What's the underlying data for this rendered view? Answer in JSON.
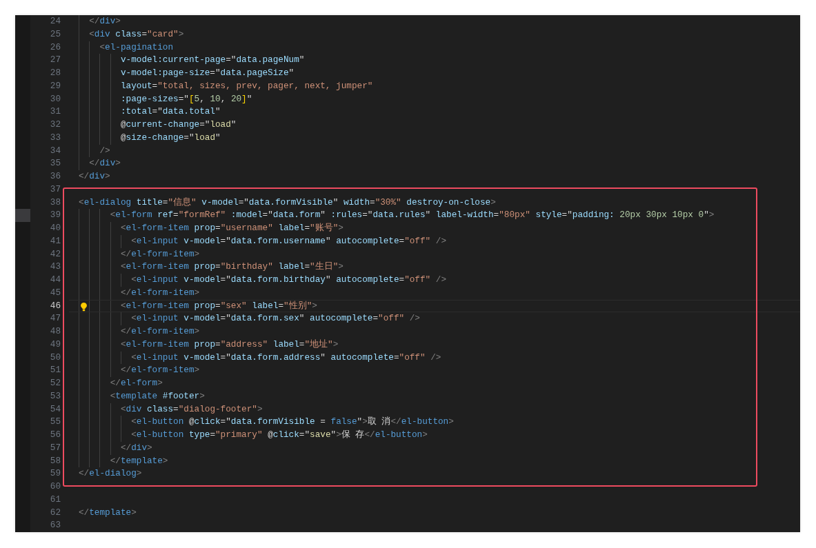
{
  "editor": {
    "lines": [
      {
        "number": "24",
        "tokens": [
          {
            "kind": "punct",
            "text": "  </"
          },
          {
            "kind": "tag",
            "text": "div"
          },
          {
            "kind": "punct",
            "text": ">"
          }
        ]
      },
      {
        "number": "25",
        "tokens": [
          {
            "kind": "punct",
            "text": "  <"
          },
          {
            "kind": "tag",
            "text": "div"
          },
          {
            "kind": "attr",
            "text": " class"
          },
          {
            "kind": "op",
            "text": "="
          },
          {
            "kind": "str",
            "text": "\"card\""
          },
          {
            "kind": "punct",
            "text": ">"
          }
        ]
      },
      {
        "number": "26",
        "tokens": [
          {
            "kind": "punct",
            "text": "    <"
          },
          {
            "kind": "tag",
            "text": "el-pagination"
          }
        ]
      },
      {
        "number": "27",
        "tokens": [
          {
            "kind": "attr",
            "text": "        v-model:current-page"
          },
          {
            "kind": "op",
            "text": "=\""
          },
          {
            "kind": "expr",
            "text": "data.pageNum"
          },
          {
            "kind": "op",
            "text": "\""
          }
        ]
      },
      {
        "number": "28",
        "tokens": [
          {
            "kind": "attr",
            "text": "        v-model:page-size"
          },
          {
            "kind": "op",
            "text": "=\""
          },
          {
            "kind": "expr",
            "text": "data.pageSize"
          },
          {
            "kind": "op",
            "text": "\""
          }
        ]
      },
      {
        "number": "29",
        "tokens": [
          {
            "kind": "attr",
            "text": "        layout"
          },
          {
            "kind": "op",
            "text": "="
          },
          {
            "kind": "str",
            "text": "\"total, sizes, prev, pager, next, jumper\""
          }
        ]
      },
      {
        "number": "30",
        "tokens": [
          {
            "kind": "attr",
            "text": "        :page-sizes"
          },
          {
            "kind": "op",
            "text": "=\""
          },
          {
            "kind": "brace",
            "text": "["
          },
          {
            "kind": "num",
            "text": "5"
          },
          {
            "kind": "op",
            "text": ", "
          },
          {
            "kind": "num",
            "text": "10"
          },
          {
            "kind": "op",
            "text": ", "
          },
          {
            "kind": "num",
            "text": "20"
          },
          {
            "kind": "brace",
            "text": "]"
          },
          {
            "kind": "op",
            "text": "\""
          }
        ]
      },
      {
        "number": "31",
        "tokens": [
          {
            "kind": "attr",
            "text": "        :total"
          },
          {
            "kind": "op",
            "text": "=\""
          },
          {
            "kind": "expr",
            "text": "data.total"
          },
          {
            "kind": "op",
            "text": "\""
          }
        ]
      },
      {
        "number": "32",
        "tokens": [
          {
            "kind": "op",
            "text": "        @"
          },
          {
            "kind": "attr",
            "text": "current-change"
          },
          {
            "kind": "op",
            "text": "=\""
          },
          {
            "kind": "func",
            "text": "load"
          },
          {
            "kind": "op",
            "text": "\""
          }
        ]
      },
      {
        "number": "33",
        "tokens": [
          {
            "kind": "op",
            "text": "        @"
          },
          {
            "kind": "attr",
            "text": "size-change"
          },
          {
            "kind": "op",
            "text": "=\""
          },
          {
            "kind": "func",
            "text": "load"
          },
          {
            "kind": "op",
            "text": "\""
          }
        ]
      },
      {
        "number": "34",
        "tokens": [
          {
            "kind": "punct",
            "text": "    />"
          }
        ]
      },
      {
        "number": "35",
        "tokens": [
          {
            "kind": "punct",
            "text": "  </"
          },
          {
            "kind": "tag",
            "text": "div"
          },
          {
            "kind": "punct",
            "text": ">"
          }
        ]
      },
      {
        "number": "36",
        "tokens": [
          {
            "kind": "punct",
            "text": "</"
          },
          {
            "kind": "tag",
            "text": "div"
          },
          {
            "kind": "punct",
            "text": ">"
          }
        ]
      },
      {
        "number": "37"
      }
    ],
    "highlight_box": {
      "lines": [
        {
          "number": "38",
          "tokens": [
            {
              "kind": "punct",
              "text": "<"
            },
            {
              "kind": "tag",
              "text": "el-dialog"
            },
            {
              "kind": "attr",
              "text": " title"
            },
            {
              "kind": "op",
              "text": "="
            },
            {
              "kind": "str",
              "text": "\"信息\""
            },
            {
              "kind": "attr",
              "text": " v-model"
            },
            {
              "kind": "op",
              "text": "=\""
            },
            {
              "kind": "expr",
              "text": "data.formVisible"
            },
            {
              "kind": "op",
              "text": "\""
            },
            {
              "kind": "attr",
              "text": " width"
            },
            {
              "kind": "op",
              "text": "="
            },
            {
              "kind": "str",
              "text": "\"30%\""
            },
            {
              "kind": "attr",
              "text": " destroy-on-close"
            },
            {
              "kind": "punct",
              "text": ">"
            }
          ]
        },
        {
          "number": "39",
          "marked": true,
          "tokens": [
            {
              "kind": "punct",
              "text": "      <"
            },
            {
              "kind": "tag",
              "text": "el-form"
            },
            {
              "kind": "attr",
              "text": " ref"
            },
            {
              "kind": "op",
              "text": "="
            },
            {
              "kind": "str",
              "text": "\"formRef\""
            },
            {
              "kind": "attr",
              "text": " :model"
            },
            {
              "kind": "op",
              "text": "=\""
            },
            {
              "kind": "expr",
              "text": "data.form"
            },
            {
              "kind": "op",
              "text": "\""
            },
            {
              "kind": "attr",
              "text": " :rules"
            },
            {
              "kind": "op",
              "text": "=\""
            },
            {
              "kind": "expr",
              "text": "data.rules"
            },
            {
              "kind": "op",
              "text": "\""
            },
            {
              "kind": "attr",
              "text": " label-width"
            },
            {
              "kind": "op",
              "text": "="
            },
            {
              "kind": "str",
              "text": "\"80px\""
            },
            {
              "kind": "attr",
              "text": " style"
            },
            {
              "kind": "op",
              "text": "=\""
            },
            {
              "kind": "expr",
              "text": "padding:"
            },
            {
              "kind": "num",
              "text": " 20px 30px 10px 0"
            },
            {
              "kind": "op",
              "text": "\""
            },
            {
              "kind": "punct",
              "text": ">"
            }
          ]
        },
        {
          "number": "40",
          "tokens": [
            {
              "kind": "punct",
              "text": "        <"
            },
            {
              "kind": "tag",
              "text": "el-form-item"
            },
            {
              "kind": "attr",
              "text": " prop"
            },
            {
              "kind": "op",
              "text": "="
            },
            {
              "kind": "str",
              "text": "\"username\""
            },
            {
              "kind": "attr",
              "text": " label"
            },
            {
              "kind": "op",
              "text": "="
            },
            {
              "kind": "str",
              "text": "\"账号\""
            },
            {
              "kind": "punct",
              "text": ">"
            }
          ]
        },
        {
          "number": "41",
          "tokens": [
            {
              "kind": "punct",
              "text": "          <"
            },
            {
              "kind": "tag",
              "text": "el-input"
            },
            {
              "kind": "attr",
              "text": " v-model"
            },
            {
              "kind": "op",
              "text": "=\""
            },
            {
              "kind": "expr",
              "text": "data.form.username"
            },
            {
              "kind": "op",
              "text": "\""
            },
            {
              "kind": "attr",
              "text": " autocomplete"
            },
            {
              "kind": "op",
              "text": "="
            },
            {
              "kind": "str",
              "text": "\"off\""
            },
            {
              "kind": "punct",
              "text": " />"
            }
          ]
        },
        {
          "number": "42",
          "tokens": [
            {
              "kind": "punct",
              "text": "        </"
            },
            {
              "kind": "tag",
              "text": "el-form-item"
            },
            {
              "kind": "punct",
              "text": ">"
            }
          ]
        },
        {
          "number": "43",
          "tokens": [
            {
              "kind": "punct",
              "text": "        <"
            },
            {
              "kind": "tag",
              "text": "el-form-item"
            },
            {
              "kind": "attr",
              "text": " prop"
            },
            {
              "kind": "op",
              "text": "="
            },
            {
              "kind": "str",
              "text": "\"birthday\""
            },
            {
              "kind": "attr",
              "text": " label"
            },
            {
              "kind": "op",
              "text": "="
            },
            {
              "kind": "str",
              "text": "\"生日\""
            },
            {
              "kind": "punct",
              "text": ">"
            }
          ]
        },
        {
          "number": "44",
          "tokens": [
            {
              "kind": "punct",
              "text": "          <"
            },
            {
              "kind": "tag",
              "text": "el-input"
            },
            {
              "kind": "attr",
              "text": " v-model"
            },
            {
              "kind": "op",
              "text": "=\""
            },
            {
              "kind": "expr",
              "text": "data.form.birthday"
            },
            {
              "kind": "op",
              "text": "\""
            },
            {
              "kind": "attr",
              "text": " autocomplete"
            },
            {
              "kind": "op",
              "text": "="
            },
            {
              "kind": "str",
              "text": "\"off\""
            },
            {
              "kind": "punct",
              "text": " />"
            }
          ]
        },
        {
          "number": "45",
          "tokens": [
            {
              "kind": "punct",
              "text": "        </"
            },
            {
              "kind": "tag",
              "text": "el-form-item"
            },
            {
              "kind": "punct",
              "text": ">"
            }
          ]
        },
        {
          "number": "46",
          "current": true,
          "lightbulb": true,
          "tokens": [
            {
              "kind": "punct",
              "text": "        <"
            },
            {
              "kind": "tag",
              "text": "el-form-item"
            },
            {
              "kind": "attr",
              "text": " prop"
            },
            {
              "kind": "op",
              "text": "="
            },
            {
              "kind": "str",
              "text": "\"sex\""
            },
            {
              "kind": "attr",
              "text": " label"
            },
            {
              "kind": "op",
              "text": "="
            },
            {
              "kind": "str",
              "text": "\"性别\""
            },
            {
              "kind": "punct",
              "text": ">"
            }
          ]
        },
        {
          "number": "47",
          "tokens": [
            {
              "kind": "punct",
              "text": "          <"
            },
            {
              "kind": "tag",
              "text": "el-input"
            },
            {
              "kind": "attr",
              "text": " v-model"
            },
            {
              "kind": "op",
              "text": "=\""
            },
            {
              "kind": "expr",
              "text": "data.form.sex"
            },
            {
              "kind": "op",
              "text": "\""
            },
            {
              "kind": "attr",
              "text": " autocomplete"
            },
            {
              "kind": "op",
              "text": "="
            },
            {
              "kind": "str",
              "text": "\"off\""
            },
            {
              "kind": "punct",
              "text": " />"
            }
          ]
        },
        {
          "number": "48",
          "tokens": [
            {
              "kind": "punct",
              "text": "        </"
            },
            {
              "kind": "tag",
              "text": "el-form-item"
            },
            {
              "kind": "punct",
              "text": ">"
            }
          ]
        },
        {
          "number": "49",
          "tokens": [
            {
              "kind": "punct",
              "text": "        <"
            },
            {
              "kind": "tag",
              "text": "el-form-item"
            },
            {
              "kind": "attr",
              "text": " prop"
            },
            {
              "kind": "op",
              "text": "="
            },
            {
              "kind": "str",
              "text": "\"address\""
            },
            {
              "kind": "attr",
              "text": " label"
            },
            {
              "kind": "op",
              "text": "="
            },
            {
              "kind": "str",
              "text": "\"地址\""
            },
            {
              "kind": "punct",
              "text": ">"
            }
          ]
        },
        {
          "number": "50",
          "tokens": [
            {
              "kind": "punct",
              "text": "          <"
            },
            {
              "kind": "tag",
              "text": "el-input"
            },
            {
              "kind": "attr",
              "text": " v-model"
            },
            {
              "kind": "op",
              "text": "=\""
            },
            {
              "kind": "expr",
              "text": "data.form.address"
            },
            {
              "kind": "op",
              "text": "\""
            },
            {
              "kind": "attr",
              "text": " autocomplete"
            },
            {
              "kind": "op",
              "text": "="
            },
            {
              "kind": "str",
              "text": "\"off\""
            },
            {
              "kind": "punct",
              "text": " />"
            }
          ]
        },
        {
          "number": "51",
          "tokens": [
            {
              "kind": "punct",
              "text": "        </"
            },
            {
              "kind": "tag",
              "text": "el-form-item"
            },
            {
              "kind": "punct",
              "text": ">"
            }
          ]
        },
        {
          "number": "52",
          "tokens": [
            {
              "kind": "punct",
              "text": "      </"
            },
            {
              "kind": "tag",
              "text": "el-form"
            },
            {
              "kind": "punct",
              "text": ">"
            }
          ]
        },
        {
          "number": "53",
          "tokens": [
            {
              "kind": "punct",
              "text": "      <"
            },
            {
              "kind": "tag",
              "text": "template"
            },
            {
              "kind": "attr",
              "text": " #footer"
            },
            {
              "kind": "punct",
              "text": ">"
            }
          ]
        },
        {
          "number": "54",
          "tokens": [
            {
              "kind": "punct",
              "text": "        <"
            },
            {
              "kind": "tag",
              "text": "div"
            },
            {
              "kind": "attr",
              "text": " class"
            },
            {
              "kind": "op",
              "text": "="
            },
            {
              "kind": "str",
              "text": "\"dialog-footer\""
            },
            {
              "kind": "punct",
              "text": ">"
            }
          ]
        },
        {
          "number": "55",
          "tokens": [
            {
              "kind": "punct",
              "text": "          <"
            },
            {
              "kind": "tag",
              "text": "el-button"
            },
            {
              "kind": "op",
              "text": " @"
            },
            {
              "kind": "attr",
              "text": "click"
            },
            {
              "kind": "op",
              "text": "=\""
            },
            {
              "kind": "expr",
              "text": "data.formVisible"
            },
            {
              "kind": "op",
              "text": " = "
            },
            {
              "kind": "kw",
              "text": "false"
            },
            {
              "kind": "op",
              "text": "\""
            },
            {
              "kind": "punct",
              "text": ">"
            },
            {
              "kind": "text",
              "text": "取 消"
            },
            {
              "kind": "punct",
              "text": "</"
            },
            {
              "kind": "tag",
              "text": "el-button"
            },
            {
              "kind": "punct",
              "text": ">"
            }
          ]
        },
        {
          "number": "56",
          "tokens": [
            {
              "kind": "punct",
              "text": "          <"
            },
            {
              "kind": "tag",
              "text": "el-button"
            },
            {
              "kind": "attr",
              "text": " type"
            },
            {
              "kind": "op",
              "text": "="
            },
            {
              "kind": "str",
              "text": "\"primary\""
            },
            {
              "kind": "op",
              "text": " @"
            },
            {
              "kind": "attr",
              "text": "click"
            },
            {
              "kind": "op",
              "text": "=\""
            },
            {
              "kind": "func",
              "text": "save"
            },
            {
              "kind": "op",
              "text": "\""
            },
            {
              "kind": "punct",
              "text": ">"
            },
            {
              "kind": "text",
              "text": "保 存"
            },
            {
              "kind": "punct",
              "text": "</"
            },
            {
              "kind": "tag",
              "text": "el-button"
            },
            {
              "kind": "punct",
              "text": ">"
            }
          ]
        },
        {
          "number": "57",
          "tokens": [
            {
              "kind": "punct",
              "text": "        </"
            },
            {
              "kind": "tag",
              "text": "div"
            },
            {
              "kind": "punct",
              "text": ">"
            }
          ]
        },
        {
          "number": "58",
          "tokens": [
            {
              "kind": "punct",
              "text": "      </"
            },
            {
              "kind": "tag",
              "text": "template"
            },
            {
              "kind": "punct",
              "text": ">"
            }
          ]
        },
        {
          "number": "59",
          "tokens": [
            {
              "kind": "punct",
              "text": "</"
            },
            {
              "kind": "tag",
              "text": "el-dialog"
            },
            {
              "kind": "punct",
              "text": ">"
            }
          ]
        }
      ]
    },
    "after_lines": [
      {
        "number": "60"
      },
      {
        "number": "61"
      },
      {
        "number": "62",
        "tokens": [
          {
            "kind": "punct",
            "text": "</"
          },
          {
            "kind": "tag",
            "text": "template"
          },
          {
            "kind": "punct",
            "text": ">"
          }
        ]
      },
      {
        "number": "63"
      }
    ]
  }
}
